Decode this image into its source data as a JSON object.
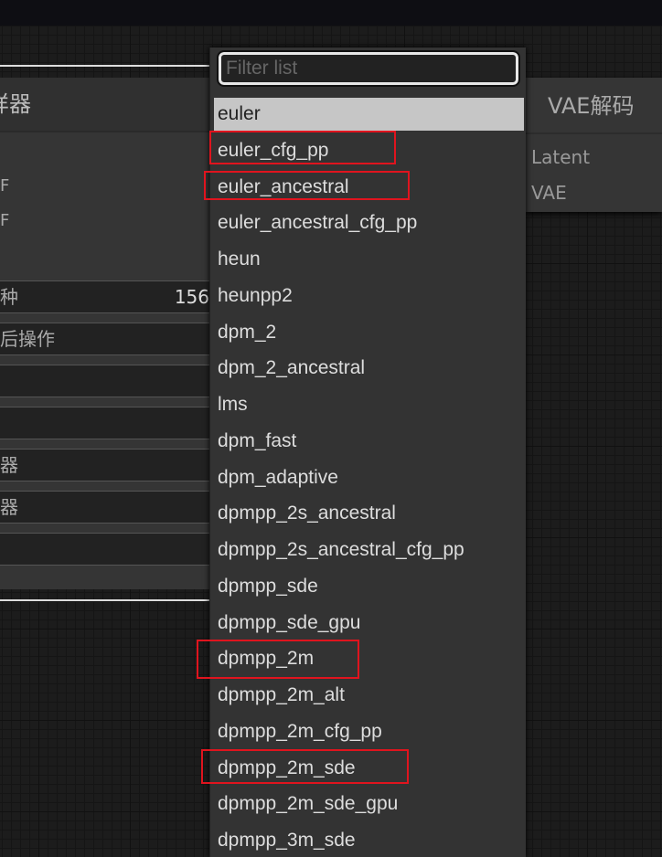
{
  "left_node": {
    "title": "样器",
    "ports": [
      "F",
      "F"
    ],
    "widgets": [
      {
        "label": "种",
        "value": "156"
      },
      {
        "label": "后操作",
        "value": ""
      },
      {
        "label": "",
        "value": ""
      },
      {
        "label": "",
        "value": ""
      },
      {
        "label": "器",
        "value": ""
      },
      {
        "label": "器",
        "value": ""
      },
      {
        "label": "",
        "value": ""
      }
    ]
  },
  "vae_node": {
    "title": "VAE解码",
    "inputs": [
      "Latent",
      "VAE"
    ]
  },
  "dropdown": {
    "filter_placeholder": "Filter list",
    "filter_value": "",
    "selected": "euler",
    "items": [
      "euler",
      "euler_cfg_pp",
      "euler_ancestral",
      "euler_ancestral_cfg_pp",
      "heun",
      "heunpp2",
      "dpm_2",
      "dpm_2_ancestral",
      "lms",
      "dpm_fast",
      "dpm_adaptive",
      "dpmpp_2s_ancestral",
      "dpmpp_2s_ancestral_cfg_pp",
      "dpmpp_sde",
      "dpmpp_sde_gpu",
      "dpmpp_2m",
      "dpmpp_2m_alt",
      "dpmpp_2m_cfg_pp",
      "dpmpp_2m_sde",
      "dpmpp_2m_sde_gpu",
      "dpmpp_3m_sde"
    ],
    "highlighted": [
      "euler_cfg_pp",
      "euler_ancestral",
      "dpmpp_2m",
      "dpmpp_2m_sde"
    ]
  },
  "colors": {
    "highlight_box": "#e0141e",
    "selected_bg": "#c6c6c6"
  }
}
